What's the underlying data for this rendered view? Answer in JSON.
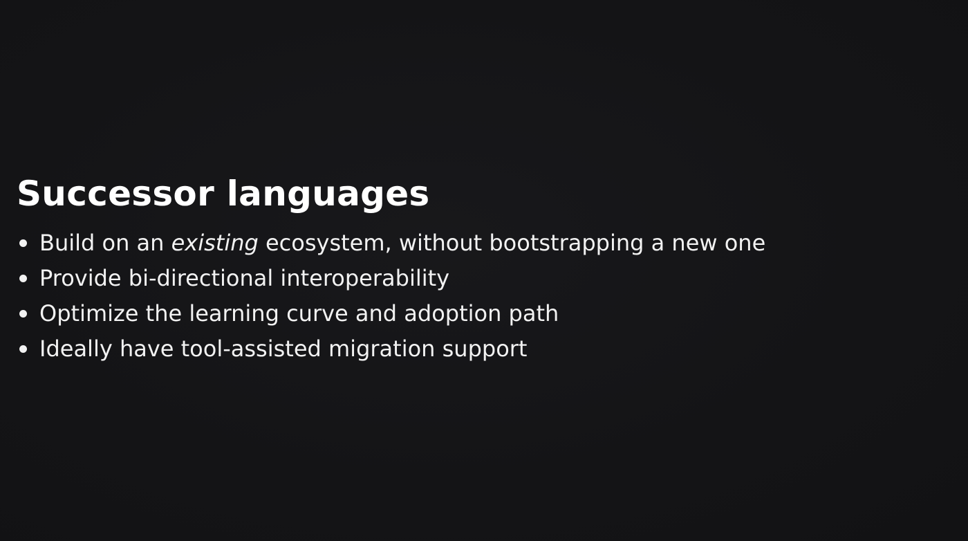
{
  "slide": {
    "title": "Successor languages",
    "bullets": [
      {
        "before": "Build on an ",
        "emphasis": "existing",
        "after": " ecosystem, without bootstrapping a new one"
      },
      {
        "text": "Provide bi-directional interoperability"
      },
      {
        "text": "Optimize the learning curve and adoption path"
      },
      {
        "text": "Ideally have tool-assisted migration support"
      }
    ]
  },
  "colors": {
    "background": "#141416",
    "title": "#ffffff",
    "body_text": "#f2f2f2"
  }
}
